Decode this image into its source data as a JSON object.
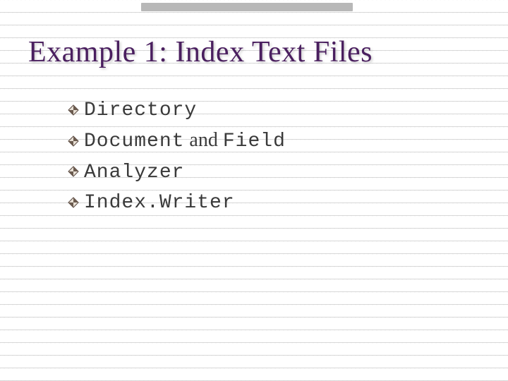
{
  "slide": {
    "title": "Example 1: Index Text Files",
    "bullets": [
      {
        "segments": [
          {
            "text": "Directory",
            "style": "code"
          }
        ]
      },
      {
        "segments": [
          {
            "text": "Document",
            "style": "code"
          },
          {
            "text": " and ",
            "style": "regular"
          },
          {
            "text": "Field",
            "style": "code"
          }
        ]
      },
      {
        "segments": [
          {
            "text": "Analyzer",
            "style": "code"
          }
        ]
      },
      {
        "segments": [
          {
            "text": "Index.Writer",
            "style": "code"
          }
        ]
      }
    ]
  },
  "colors": {
    "title": "#4a1f5f",
    "bullet_stroke": "#5a4a42",
    "bullet_fill_light": "#e8e0d5",
    "bullet_fill_dark": "#6b5b4f"
  }
}
